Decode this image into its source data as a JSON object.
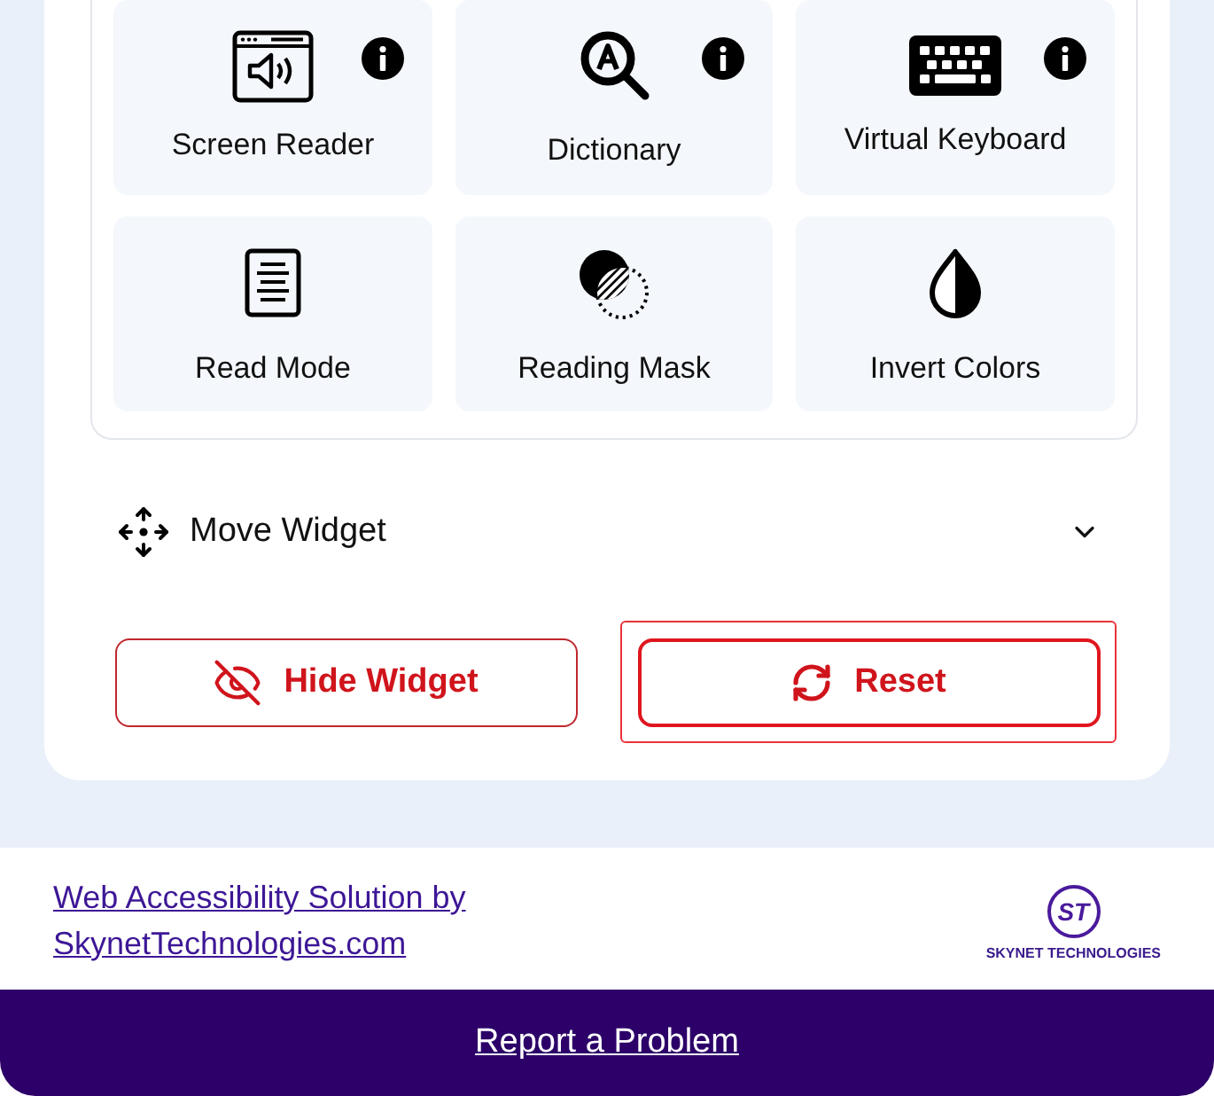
{
  "features": [
    {
      "label": "Screen Reader",
      "kind": "screen-reader",
      "info": true
    },
    {
      "label": "Dictionary",
      "kind": "dictionary",
      "info": true
    },
    {
      "label": "Virtual Keyboard",
      "kind": "keyboard",
      "info": true
    },
    {
      "label": "Read Mode",
      "kind": "read-mode",
      "info": false
    },
    {
      "label": "Reading Mask",
      "kind": "reading-mask",
      "info": false
    },
    {
      "label": "Invert Colors",
      "kind": "invert",
      "info": false
    }
  ],
  "move_widget": {
    "label": "Move Widget",
    "expanded": false
  },
  "buttons": [
    {
      "label": "Hide Widget",
      "kind": "hide",
      "focused": false
    },
    {
      "label": "Reset",
      "kind": "reset",
      "focused": true
    }
  ],
  "footer": {
    "link": "Web Accessibility Solution by SkynetTechnologies.com",
    "logo_mark": "ST",
    "logo_text": "SKYNET TECHNOLOGIES"
  },
  "report": {
    "label": "Report a Problem"
  }
}
